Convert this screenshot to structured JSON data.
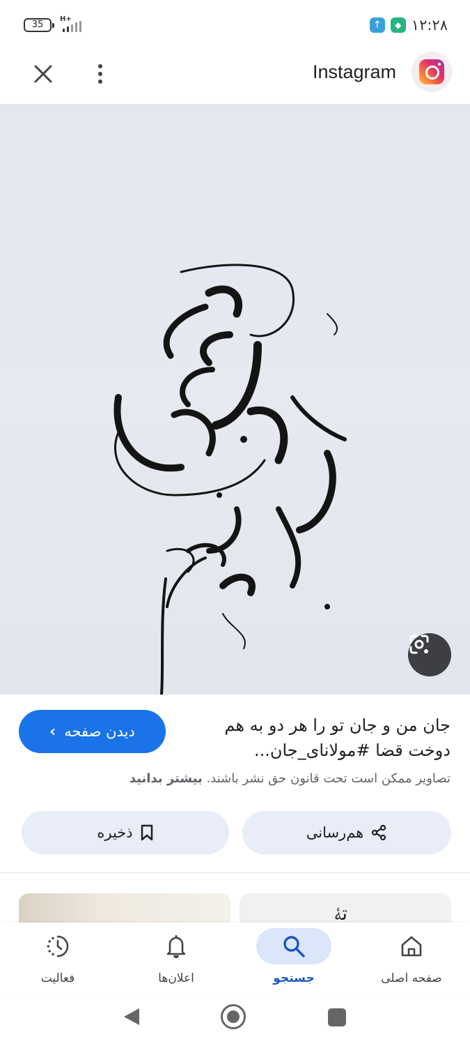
{
  "status_bar": {
    "battery_level": "35",
    "network_type": "H+",
    "time": "۱۲:۲۸"
  },
  "header": {
    "source_title": "Instagram",
    "logo_icon": "instagram-logo"
  },
  "image": {
    "lens_button_icon": "google-lens-icon"
  },
  "result": {
    "visit_label": "دیدن صفحه",
    "title": "جان من و جان تو را هر دو به هم دوخت قضا #مولانای_جان...",
    "copyright_text": "تصاویر ممکن است تحت قانون حق نشر باشند.",
    "learn_more": "بیشتر بدانید",
    "share_label": "هم‌رسانی",
    "save_label": "ذخیره"
  },
  "bottom_nav": {
    "items": [
      {
        "label": "فعالیت",
        "icon": "activity-icon"
      },
      {
        "label": "اعلان‌ها",
        "icon": "bell-icon"
      },
      {
        "label": "جستجو",
        "icon": "search-icon",
        "active": true
      },
      {
        "label": "صفحه اصلی",
        "icon": "home-icon"
      }
    ]
  },
  "colors": {
    "accent": "#1a73e8",
    "active_nav_bg": "#dce6fa",
    "pill_bg": "#e8edf8"
  }
}
